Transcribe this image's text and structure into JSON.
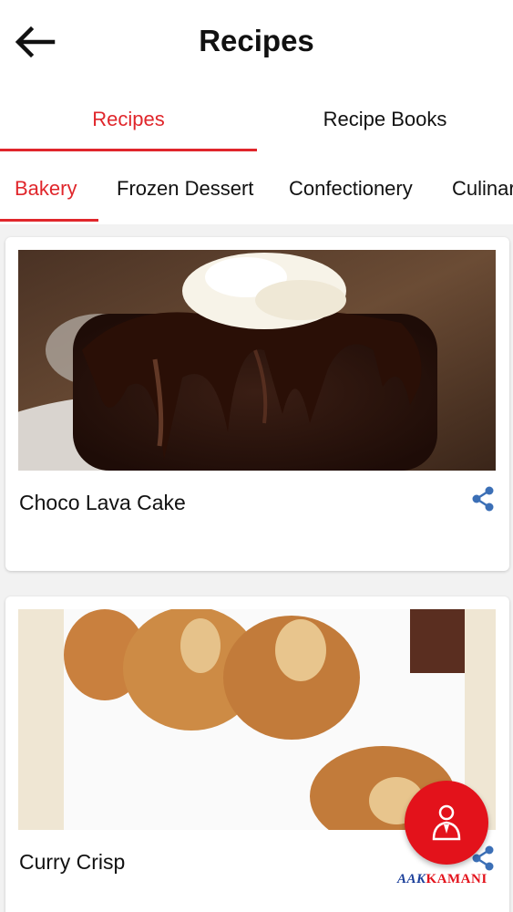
{
  "header": {
    "title": "Recipes",
    "back_icon": "arrow-left-icon"
  },
  "main_tabs": [
    {
      "label": "Recipes",
      "active": true
    },
    {
      "label": "Recipe Books",
      "active": false
    }
  ],
  "category_tabs": [
    {
      "label": "Bakery",
      "active": true
    },
    {
      "label": "Frozen Dessert",
      "active": false
    },
    {
      "label": "Confectionery",
      "active": false
    },
    {
      "label": "Culinar",
      "active": false
    }
  ],
  "recipes": [
    {
      "title": "Choco Lava Cake",
      "share_icon": "share-icon"
    },
    {
      "title": "Curry Crisp",
      "share_icon": "share-icon"
    }
  ],
  "fab": {
    "icon": "person-icon"
  },
  "brand": {
    "part1": "AAK",
    "part2": "KAMANI"
  },
  "colors": {
    "accent": "#e0262b",
    "fab": "#e3121b",
    "share": "#3b6fb6",
    "brand_blue": "#1b3f9a"
  }
}
